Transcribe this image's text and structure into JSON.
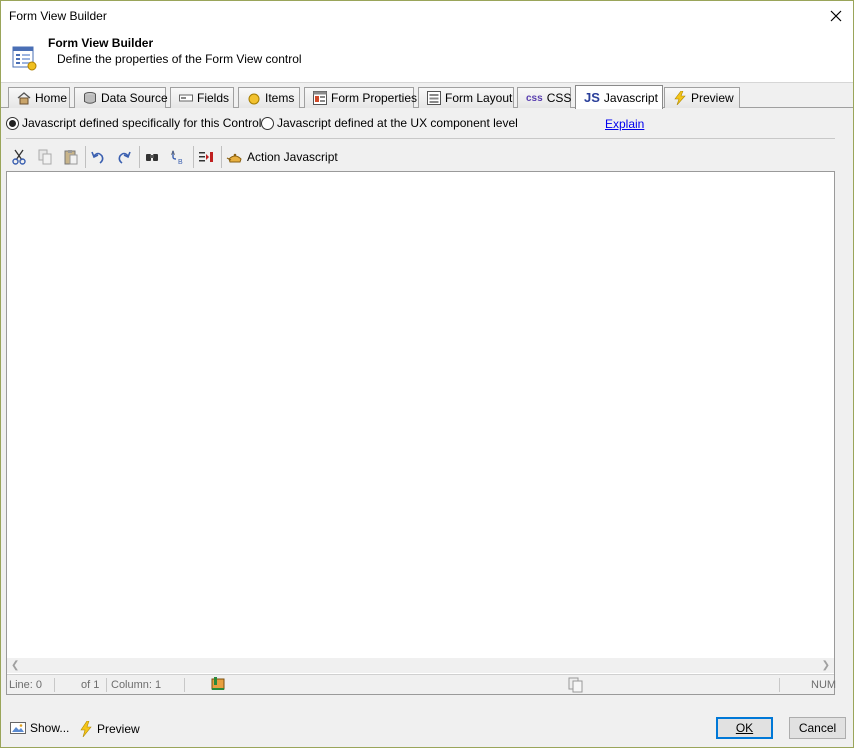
{
  "window": {
    "title": "Form View Builder"
  },
  "header": {
    "title": "Form View Builder",
    "description": "Define the properties of the Form View control"
  },
  "tabs": [
    {
      "label": "Home",
      "icon": "home-icon"
    },
    {
      "label": "Data Source",
      "icon": "database-icon"
    },
    {
      "label": "Fields",
      "icon": "fields-icon"
    },
    {
      "label": "Items",
      "icon": "items-icon"
    },
    {
      "label": "Form Properties",
      "icon": "form-properties-icon"
    },
    {
      "label": "Form Layout",
      "icon": "form-layout-icon"
    },
    {
      "label": "CSS",
      "icon": "css-icon",
      "icon_text": "css"
    },
    {
      "label": "Javascript",
      "icon": "js-icon",
      "icon_text": "JS",
      "active": true
    },
    {
      "label": "Preview",
      "icon": "lightning-icon"
    }
  ],
  "mode": {
    "option_control": "Javascript defined specifically for this Control",
    "option_component": "Javascript defined at the UX component level",
    "selected": "option_control",
    "explain_link": "Explain"
  },
  "toolbar": {
    "action_label": "Action Javascript",
    "icons": [
      "cut-icon",
      "copy-icon",
      "paste-icon",
      "undo-icon",
      "redo-icon",
      "find-icon",
      "replace-icon",
      "indent-icon",
      "action-javascript-icon"
    ]
  },
  "editor": {
    "content": ""
  },
  "statusbar": {
    "line": "Line: 0",
    "of": "of 1",
    "column": "Column: 1",
    "num": "NUM"
  },
  "footer": {
    "show_label": "Show...",
    "preview_label": "Preview",
    "ok_label": "OK",
    "cancel_label": "Cancel"
  },
  "colors": {
    "link": "#0000ee",
    "window_border": "#9aa55a",
    "default_button_border": "#0078d7"
  }
}
